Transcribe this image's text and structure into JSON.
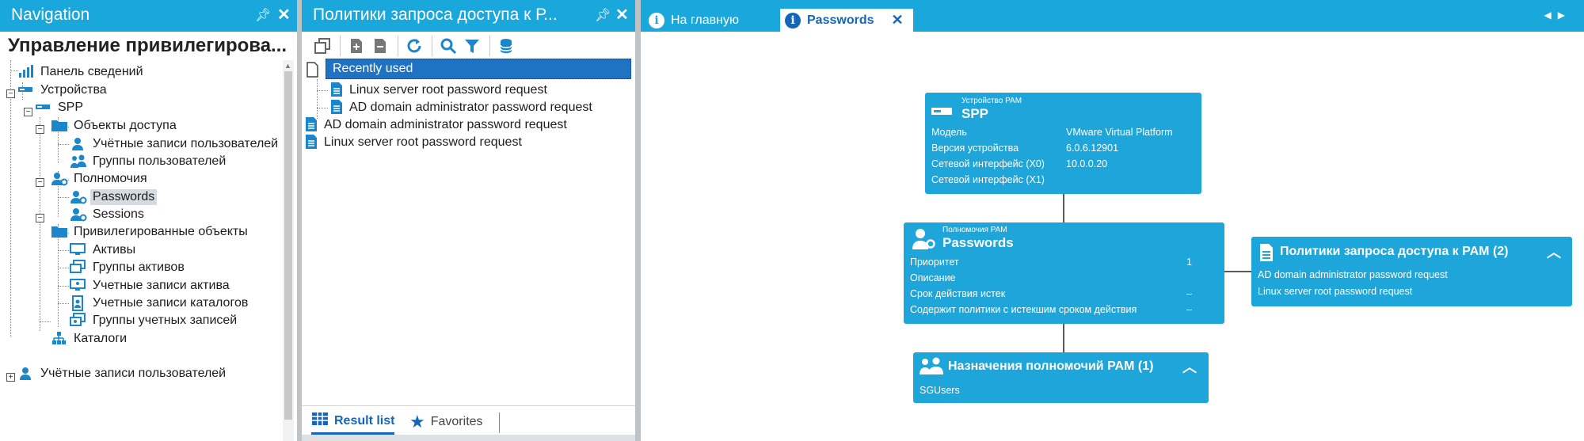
{
  "navigation": {
    "title": "Navigation",
    "heading": "Управление привилегирова...",
    "items": [
      {
        "label": "Панель сведений"
      },
      {
        "label": "Устройства"
      },
      {
        "label": "SPP"
      },
      {
        "label": "Объекты доступа"
      },
      {
        "label": "Учётные записи пользователей"
      },
      {
        "label": "Группы пользователей"
      },
      {
        "label": "Полномочия"
      },
      {
        "label": "Passwords"
      },
      {
        "label": "Sessions"
      },
      {
        "label": "Привилегированные объекты"
      },
      {
        "label": "Активы"
      },
      {
        "label": "Группы активов"
      },
      {
        "label": "Учетные записи актива"
      },
      {
        "label": "Учетные записи каталогов"
      },
      {
        "label": "Группы учетных записей"
      },
      {
        "label": "Каталоги"
      },
      {
        "label": "Учётные записи пользователей"
      }
    ]
  },
  "middle": {
    "title": "Политики запроса доступа к Р...",
    "recently_used": "Recently used",
    "recent_items": [
      {
        "label": "Linux server root password request"
      },
      {
        "label": "AD domain administrator password request"
      }
    ],
    "items": [
      {
        "label": "AD domain administrator password request"
      },
      {
        "label": "Linux server root password request"
      }
    ],
    "tabs": {
      "result_list": "Result list",
      "favorites": "Favorites"
    }
  },
  "workspace": {
    "tabs": [
      {
        "label": "На главную"
      },
      {
        "label": "Passwords"
      }
    ],
    "device_card": {
      "caption": "Устройство PAM",
      "name": "SPP",
      "rows": [
        {
          "label": "Модель",
          "value": "VMware Virtual Platform"
        },
        {
          "label": "Версия устройства",
          "value": "6.0.6.12901"
        },
        {
          "label": "Сетевой интерфейс (X0)",
          "value": "10.0.0.20"
        },
        {
          "label": "Сетевой интерфейс (X1)",
          "value": ""
        }
      ]
    },
    "entitlement_card": {
      "caption": "Полномочия PAM",
      "name": "Passwords",
      "rows": [
        {
          "label": "Приоритет",
          "value": "1"
        },
        {
          "label": "Описание",
          "value": ""
        },
        {
          "label": "Срок действия истек",
          "value": "–"
        },
        {
          "label": "Содержит политики с истекшим сроком действия",
          "value": "–"
        }
      ]
    },
    "policies_card": {
      "title": "Политики запроса доступа к PAM (2)",
      "items": [
        "AD domain administrator password request",
        "Linux server root password request"
      ]
    },
    "assignments_card": {
      "title": "Назначения полномочий PAM (1)",
      "items": [
        "SGUsers"
      ]
    }
  },
  "colors": {
    "header": "#1aa7dc",
    "card": "#1ea6da",
    "selection": "#1f73c2",
    "accent": "#1466b8"
  }
}
